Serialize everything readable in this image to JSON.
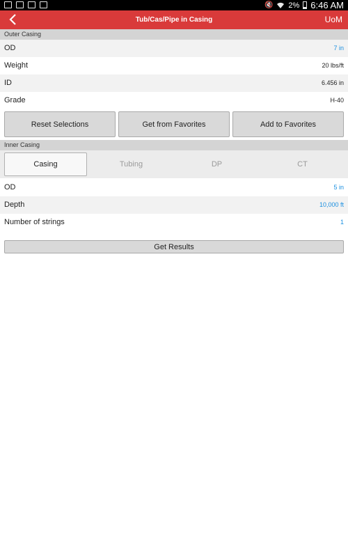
{
  "status_bar": {
    "battery_percent": "2%",
    "time": "6:46 AM",
    "left_icons": [
      "cast-icon",
      "image-icon",
      "briefcase-icon",
      "camera-icon"
    ],
    "right_icons": [
      "mute-icon",
      "wifi-icon",
      "battery-icon"
    ]
  },
  "app_bar": {
    "title": "Tub/Cas/Pipe in Casing",
    "action": "UoM",
    "color": "#d93a3a"
  },
  "outer_casing": {
    "header": "Outer Casing",
    "rows": [
      {
        "label": "OD",
        "value": "7 in"
      },
      {
        "label": "Weight",
        "value": "20 lbs/ft"
      },
      {
        "label": "ID",
        "value": "6.456 in"
      },
      {
        "label": "Grade",
        "value": "H-40"
      }
    ],
    "buttons": [
      "Reset Selections",
      "Get from Favorites",
      "Add to Favorites"
    ]
  },
  "inner_casing": {
    "header": "Inner Casing",
    "tabs": [
      "Casing",
      "Tubing",
      "DP",
      "CT"
    ],
    "active_tab": "Casing",
    "rows": [
      {
        "label": "OD",
        "value": "5 in"
      },
      {
        "label": "Depth",
        "value": "10,000 ft"
      },
      {
        "label": "Number of strings",
        "value": "1"
      }
    ]
  },
  "get_results_label": "Get Results",
  "accent_blue": "#1a8fe0"
}
